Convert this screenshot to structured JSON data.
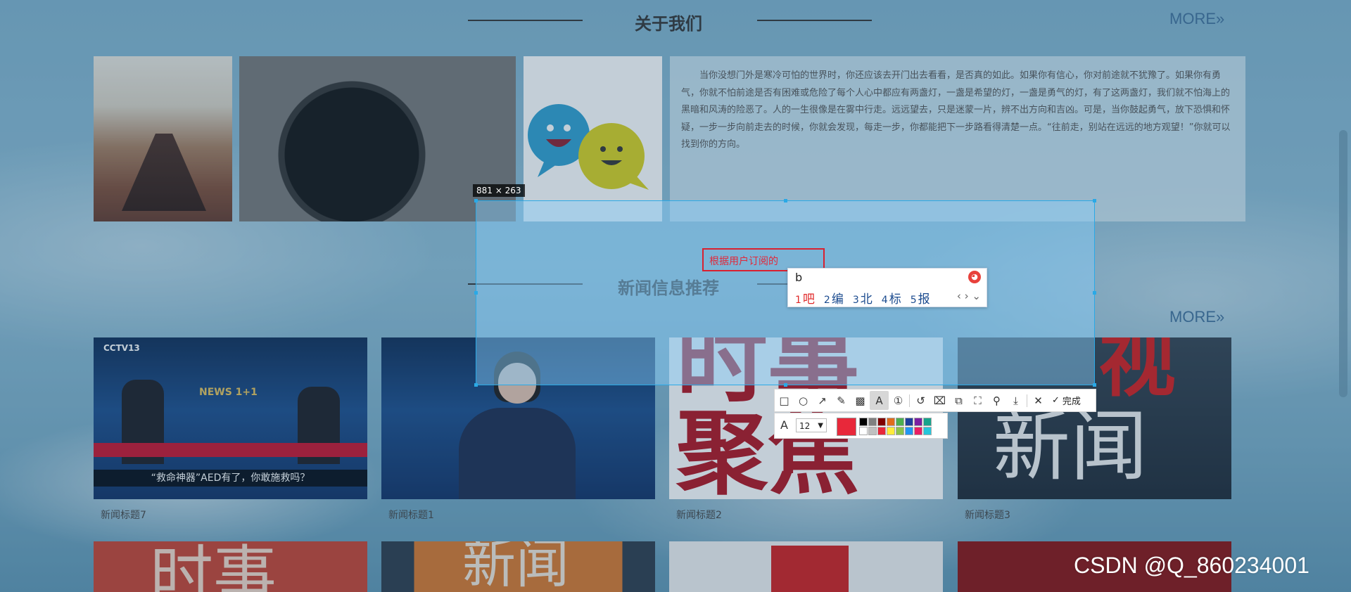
{
  "about": {
    "title": "关于我们",
    "more": "MORE»",
    "text": "当你没想门外是寒冷可怕的世界时，你还应该去开门出去看看，是否真的如此。如果你有信心，你对前途就不犹豫了。如果你有勇气，你就不怕前途是否有困难或危险了每个人心中都应有两盏灯，一盏是希望的灯，一盏是勇气的灯，有了这两盏灯，我们就不怕海上的黑暗和风涛的险恶了。人的一生很像是在雾中行走。远远望去，只是迷蒙一片，辨不出方向和吉凶。可是，当你鼓起勇气，放下恐惧和怀疑，一步一步向前走去的时候，你就会发现，每走一步，你都能把下一步路看得清楚一点。“往前走，别站在远远的地方观望！”你就可以找到你的方向。"
  },
  "news": {
    "title": "新闻信息推荐",
    "more": "MORE»",
    "items": [
      {
        "caption": "新闻标题7",
        "overlay_text": "“救命神器”AED有了，你敢施救吗？",
        "logo": "CCTV13",
        "badge": "NEWS 1+1"
      },
      {
        "caption": "新闻标题1"
      },
      {
        "caption": "新闻标题2",
        "art_text": "聚焦"
      },
      {
        "caption": "新闻标题3",
        "art_text": "新闻"
      }
    ],
    "row2_art": [
      "时事",
      "新闻",
      "",
      ""
    ]
  },
  "capture": {
    "size_label": "881 × 263",
    "text_value": "根据用户订阅的",
    "ime": {
      "input": "b",
      "candidates": [
        {
          "num": "1",
          "text": "吧"
        },
        {
          "num": "2",
          "text": "编"
        },
        {
          "num": "3",
          "text": "北"
        },
        {
          "num": "4",
          "text": "标"
        },
        {
          "num": "5",
          "text": "报"
        }
      ],
      "nav": "‹ › ⌄"
    },
    "toolbar": {
      "tools": [
        "rectangle-icon",
        "ellipse-icon",
        "arrow-icon",
        "pen-icon",
        "mosaic-icon",
        "text-icon",
        "number-icon",
        "undo-icon",
        "crop-icon",
        "copy-icon",
        "ocr-icon",
        "pin-icon",
        "save-icon"
      ],
      "cancel": "✕",
      "done": "完成"
    },
    "style": {
      "font_size": "12",
      "current_color": "#e8283a",
      "palette": [
        "#000000",
        "#808080",
        "#800000",
        "#e06c1c",
        "#4caf50",
        "#1e3f9e",
        "#7a1fa2",
        "#17a38b",
        "#ffffff",
        "#c0c0c0",
        "#e8283a",
        "#ffeb3b",
        "#8bc34a",
        "#2196f3",
        "#e91e63",
        "#26c6da"
      ]
    }
  },
  "watermark": "CSDN @Q_860234001"
}
